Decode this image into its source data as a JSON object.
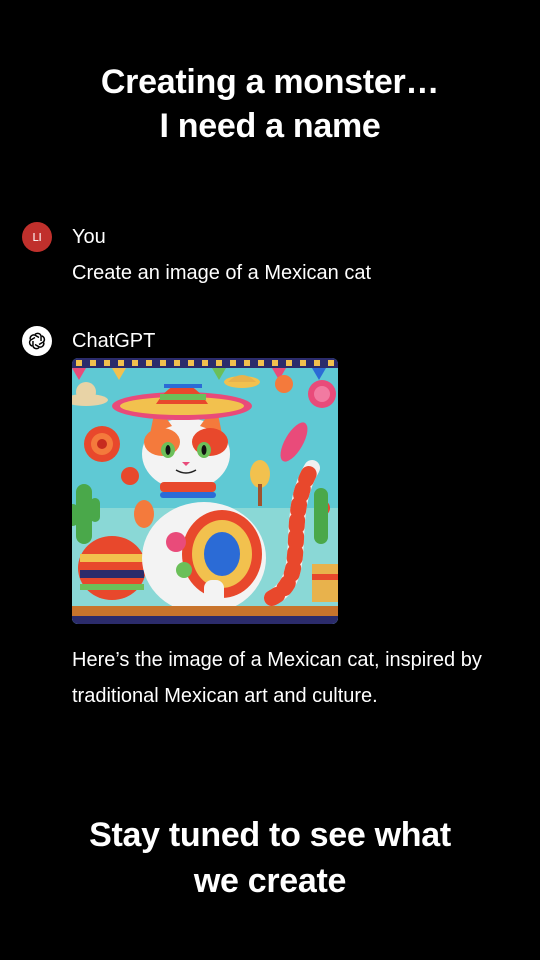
{
  "overlay": {
    "top_line1": "Creating a monster…",
    "top_line2": "I need a name",
    "bottom_line1": "Stay tuned to see what",
    "bottom_line2": "we create"
  },
  "conversation": {
    "user": {
      "avatar_initials": "LI",
      "author": "You",
      "message": "Create an image of a Mexican cat"
    },
    "assistant": {
      "avatar_icon": "openai-logo-icon",
      "author": "ChatGPT",
      "image_subject": "generated-image-mexican-cat",
      "message": "Here’s the image of a Mexican cat, inspired by traditional Mexican art and culture."
    }
  },
  "colors": {
    "background": "#000000",
    "text": "#ffffff",
    "user_avatar": "#c0302c",
    "assistant_avatar": "#ffffff"
  }
}
